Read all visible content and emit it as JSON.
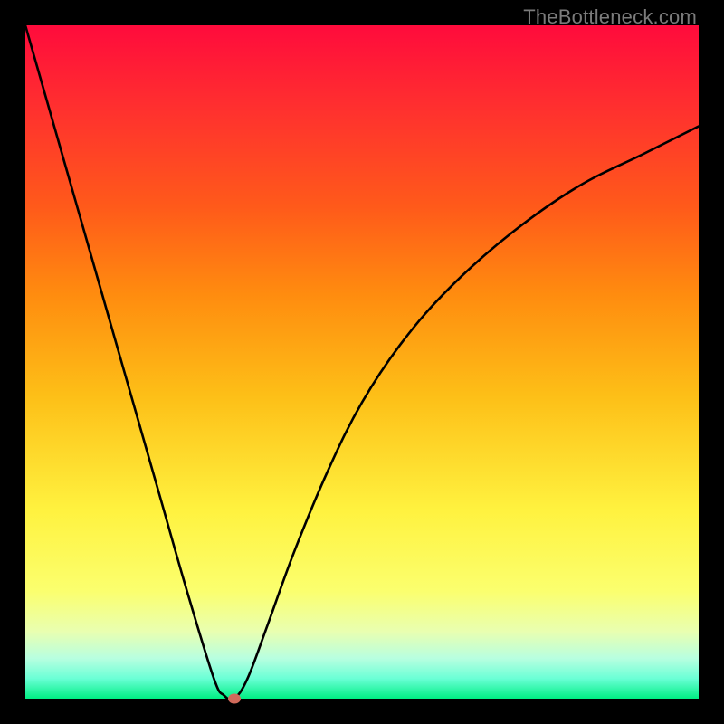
{
  "watermark": "TheBottleneck.com",
  "colors": {
    "frame": "#000000",
    "gradient_top": "#ff0b3c",
    "gradient_bottom": "#00ef83",
    "curve": "#000000",
    "dot": "#d06a5b"
  },
  "chart_data": {
    "type": "line",
    "title": "",
    "xlabel": "",
    "ylabel": "",
    "xlim": [
      0,
      100
    ],
    "ylim": [
      0,
      100
    ],
    "grid": false,
    "legend": false,
    "x": [
      0,
      4,
      8,
      12,
      16,
      20,
      24,
      28,
      29.5,
      31,
      33,
      36,
      40,
      45,
      50,
      56,
      63,
      72,
      82,
      92,
      100
    ],
    "values": [
      100,
      86,
      72,
      58,
      44,
      30,
      16,
      3,
      0.5,
      0,
      3,
      11,
      22,
      34,
      44,
      53,
      61,
      69,
      76,
      81,
      85
    ],
    "marker": {
      "x": 31,
      "y": 0
    },
    "note": "Values estimated from pixel positions; axes have no numeric labels in the source image."
  }
}
